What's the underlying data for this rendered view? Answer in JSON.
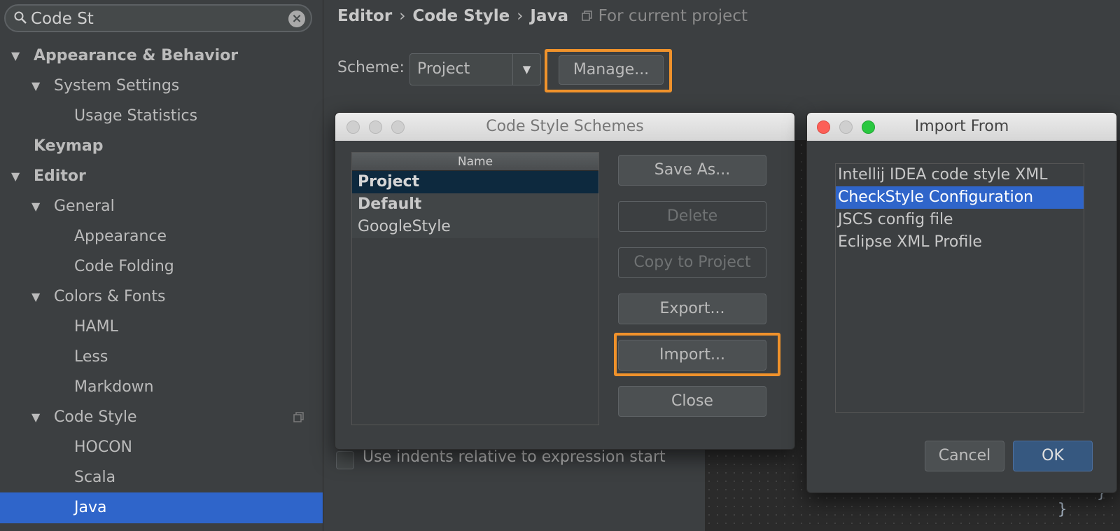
{
  "search": {
    "value": "Code St"
  },
  "tree": [
    {
      "label": "Appearance & Behavior",
      "bold": true,
      "expanded": true
    },
    {
      "label": "System Settings",
      "bold": false,
      "expanded": true
    },
    {
      "label": "Usage Statistics"
    },
    {
      "label": "Keymap",
      "bold": true
    },
    {
      "label": "Editor",
      "bold": true,
      "expanded": true
    },
    {
      "label": "General",
      "expanded": true
    },
    {
      "label": "Appearance"
    },
    {
      "label": "Code Folding"
    },
    {
      "label": "Colors & Fonts",
      "expanded": true
    },
    {
      "label": "HAML"
    },
    {
      "label": "Less"
    },
    {
      "label": "Markdown"
    },
    {
      "label": "Code Style",
      "expanded": true
    },
    {
      "label": "HOCON"
    },
    {
      "label": "Scala"
    },
    {
      "label": "Java",
      "selected": true
    }
  ],
  "breadcrumb": {
    "editor": "Editor",
    "code_style": "Code Style",
    "java": "Java",
    "scope": "For current project",
    "separator": "›"
  },
  "scheme": {
    "label": "Scheme:",
    "value": "Project",
    "manage_label": "Manage..."
  },
  "indent_option": {
    "label": "Use indents relative to expression start",
    "checked": false
  },
  "schemes_dialog": {
    "title": "Code Style Schemes",
    "column_header": "Name",
    "rows": [
      "Project",
      "Default",
      "GoogleStyle"
    ],
    "selected": "Project",
    "buttons": {
      "save_as": "Save As...",
      "delete": "Delete",
      "copy_to_project": "Copy to Project",
      "export": "Export...",
      "import": "Import...",
      "close": "Close"
    }
  },
  "import_dialog": {
    "title": "Import From",
    "options": [
      "Intellij IDEA code style XML",
      "CheckStyle Configuration",
      "JSCS config file",
      "Eclipse XML Profile"
    ],
    "selected": "CheckStyle Configuration",
    "cancel_label": "Cancel",
    "ok_label": "OK"
  },
  "colors": {
    "highlight": "#f0922b",
    "selection": "#2f65ca",
    "background": "#3c3f41"
  }
}
